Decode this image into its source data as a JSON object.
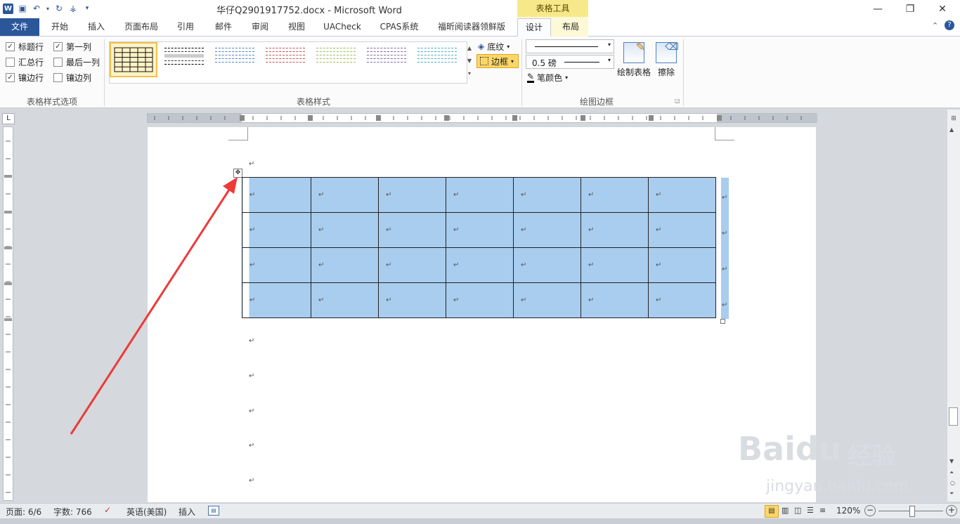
{
  "window": {
    "title": "华仔Q2901917752.docx - Microsoft Word",
    "context_tab_group": "表格工具"
  },
  "tabs": [
    "文件",
    "开始",
    "插入",
    "页面布局",
    "引用",
    "邮件",
    "审阅",
    "视图",
    "UACheck",
    "CPAS系统",
    "福昕阅读器领鲜版",
    "设计",
    "布局"
  ],
  "ribbon": {
    "style_options": {
      "label": "表格样式选项",
      "items": [
        {
          "label": "标题行",
          "checked": true
        },
        {
          "label": "第一列",
          "checked": true
        },
        {
          "label": "汇总行",
          "checked": false
        },
        {
          "label": "最后一列",
          "checked": false
        },
        {
          "label": "镶边行",
          "checked": true
        },
        {
          "label": "镶边列",
          "checked": false
        }
      ]
    },
    "table_styles": {
      "label": "表格样式",
      "shading": "底纹",
      "borders": "边框"
    },
    "draw_borders": {
      "label": "绘图边框",
      "weight": "0.5 磅",
      "pen_color": "笔颜色",
      "draw_table": "绘制表格",
      "eraser": "擦除"
    }
  },
  "document": {
    "para_mark": "↵",
    "table": {
      "rows": 4,
      "cols": 7,
      "selected_color": "#a8cdef"
    }
  },
  "status": {
    "page": "页面: 6/6",
    "words": "字数: 766",
    "language": "英语(美国)",
    "mode": "插入",
    "zoom": "120%"
  },
  "watermark": {
    "brand": "Baidu",
    "cn": "经验",
    "url": "jingyan.baidu.com"
  },
  "colors": {
    "accent": "#2b579a",
    "context": "#f7e98a",
    "arrow": "#ee3a3a"
  }
}
